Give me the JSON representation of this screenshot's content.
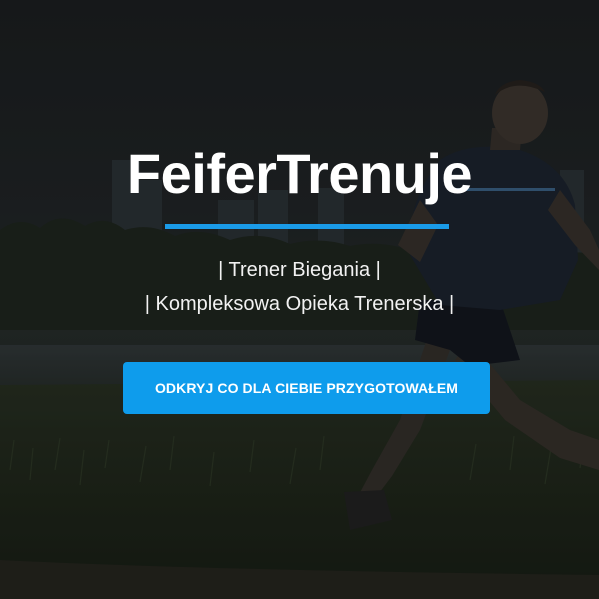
{
  "hero": {
    "title": "FeiferTrenuje",
    "tagline_1": "| Trener Biegania |",
    "tagline_2": "| Kompleksowa Opieka Trenerska |",
    "cta_label": "ODKRYJ CO DLA CIEBIE PRZYGOTOWAŁEM"
  },
  "colors": {
    "accent": "#0e9cec",
    "underline": "#1a9be8",
    "text": "#ffffff",
    "overlay": "rgba(0,0,0,0.28)"
  },
  "background": {
    "subject": "runner-photo"
  }
}
